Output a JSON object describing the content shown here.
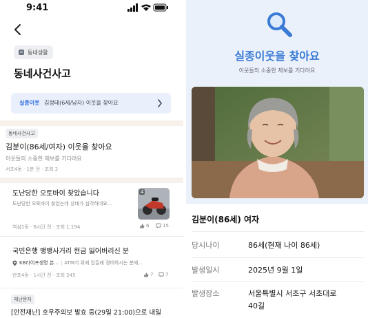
{
  "left": {
    "status_time": "9:41",
    "chip_label": "동네생활",
    "title": "동네사건사고",
    "banner": {
      "label": "실종이웃",
      "text": "김정태(6세/남자) 이웃을 찾아요"
    },
    "cards": [
      {
        "tag": "동네사건사고",
        "title": "김분이(86세/여자) 이웃을 찾아요",
        "sub": "이웃들의 소중한 제보를 기다려요",
        "meta": "서초4동 · 1분 전 · 조회 2"
      },
      {
        "title": "도난당한 오토바이 찾았습니다",
        "sub": "도난당한 오토바이 찾았는데 상태가 심각하네요...",
        "meta": "역삼1동 · 8시간 전 · 조회 1,194",
        "thumb_badge": "4",
        "likes": "6",
        "comments": "15"
      },
      {
        "title": "국민은행 뱅뱅사거리 현금 잃어버리신 분",
        "place": "KB라이프생명 본...",
        "sub": "ATM기 위에 있길래 경비하시는 분에...",
        "meta": "반포4동 · 1시간 전 · 조회 245",
        "likes": "7",
        "comments": "7"
      },
      {
        "tag": "재난문자",
        "title": "[안전재난] 호우주의보 발효 중(29일 21:00)으로 내일"
      }
    ]
  },
  "right": {
    "title": "실종이웃을 찾아요",
    "subtitle": "이웃들의 소중한 제보를 기다려요",
    "person_name": "김분이(86세) 여자",
    "rows": [
      {
        "label": "당시나이",
        "value": "86세(현재 나이 86세)"
      },
      {
        "label": "발생일시",
        "value": "2025년 9월 1일"
      },
      {
        "label": "발생장소",
        "value_line1": "서울특별시 서초구 서초대로",
        "value_line2": "40길"
      }
    ]
  },
  "colors": {
    "accent": "#3a7bd5",
    "banner_bg": "#e9f0fb",
    "right_bg": "#eaf1fb"
  }
}
